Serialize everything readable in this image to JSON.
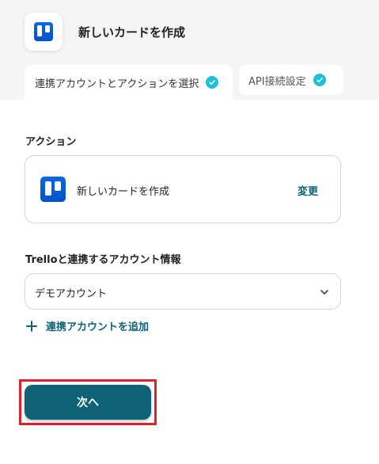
{
  "header": {
    "app_icon": "trello-icon",
    "title": "新しいカードを作成"
  },
  "tabs": [
    {
      "label": "連携アカウントとアクションを選択",
      "completed": true,
      "active": true
    },
    {
      "label": "API接続設定",
      "completed": true,
      "active": false
    }
  ],
  "action_section": {
    "label": "アクション",
    "card": {
      "icon": "trello-icon",
      "label": "新しいカードを作成",
      "change_label": "変更"
    }
  },
  "account_section": {
    "label": "Trelloと連携するアカウント情報",
    "selected_account": "デモアカウント",
    "add_account_label": "連携アカウントを追加"
  },
  "footer": {
    "next_label": "次へ"
  },
  "colors": {
    "header_bg": "#f5f5f5",
    "check": "#1ec0d6",
    "accent": "#0e6275",
    "highlight": "#e0202a",
    "trello_blue": "#0c66e4"
  }
}
